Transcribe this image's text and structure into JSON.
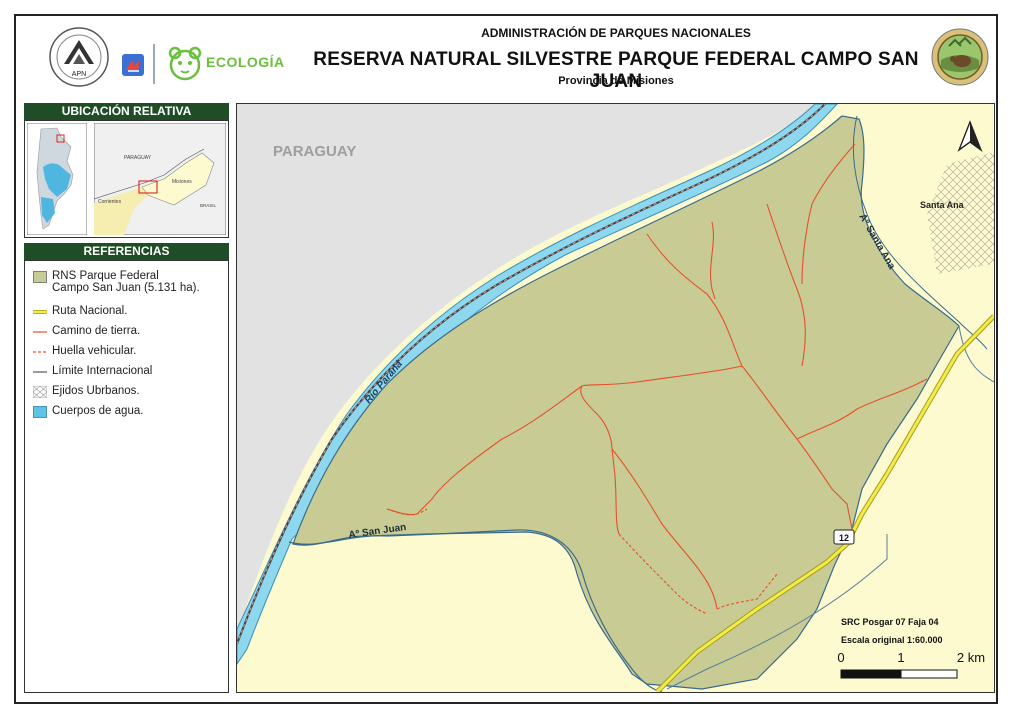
{
  "header": {
    "agency": "ADMINISTRACIÓN DE PARQUES NACIONALES",
    "title": "RESERVA NATURAL SILVESTRE PARQUE FEDERAL CAMPO SAN JUAN",
    "province": "Provincia de Misiones",
    "apn_logo_text": "APN",
    "ecologia_text": "ECOLOGÍA"
  },
  "location_panel": {
    "heading": "UBICACIÓN RELATIVA",
    "inset_labels": {
      "paraguay": "PARAGUAY",
      "misiones": "Misiones",
      "corrientes": "Corrientes",
      "brasil": "BRASIL"
    }
  },
  "legend": {
    "heading": "REFERENCIAS",
    "items": [
      {
        "label": "RNS Parque Federal",
        "label2": "Campo San Juan (5.131 ha).",
        "symbol": "park-fill"
      },
      {
        "label": "Ruta Nacional.",
        "symbol": "national-route"
      },
      {
        "label": "Camino de tierra.",
        "symbol": "dirt-road"
      },
      {
        "label": "Huella vehicular.",
        "symbol": "vehicle-track"
      },
      {
        "label": "Límite Internacional",
        "symbol": "international-border"
      },
      {
        "label": "Ejidos Ubrbanos.",
        "symbol": "urban-hatch"
      },
      {
        "label": "Cuerpos de agua.",
        "symbol": "water"
      }
    ]
  },
  "map": {
    "labels": {
      "paraguay": "PARAGUAY",
      "rio_parana": "Río Paraná",
      "arroyo_san_juan": "Aº San Juan",
      "arroyo_santa_ana": "Aº Santa Ana",
      "santa_ana": "Santa Ana",
      "route_shield": "12"
    },
    "crs": "SRC Posgar 07 Faja 04",
    "scale_text": "Escala original  1:60.000",
    "scalebar": {
      "ticks": [
        "0",
        "1",
        "2 km"
      ]
    },
    "colors": {
      "park": "#c8cc94",
      "land": "#fdfad0",
      "paraguay": "#e2e2e2",
      "water": "#8ed8ef",
      "dirt_road": "#e5502c",
      "route": "#e8e24c"
    }
  }
}
